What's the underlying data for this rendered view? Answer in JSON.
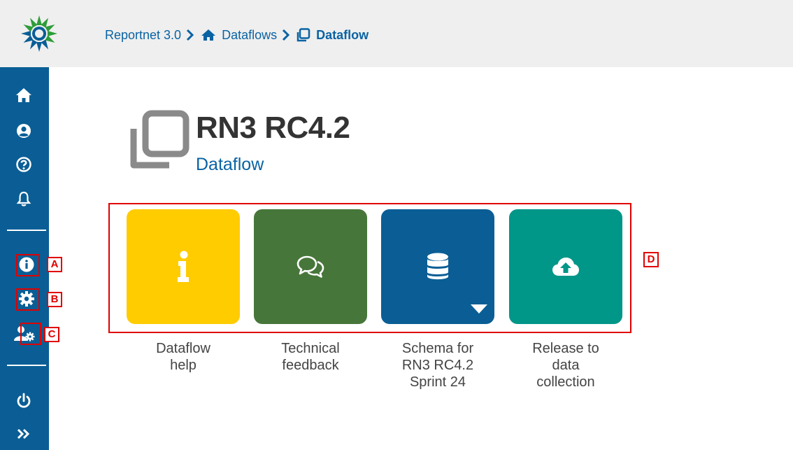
{
  "breadcrumb": {
    "items": [
      {
        "label": "Reportnet 3.0"
      },
      {
        "label": "Dataflows"
      },
      {
        "label": "Dataflow"
      }
    ]
  },
  "page": {
    "title": "RN3 RC4.2",
    "subtitle": "Dataflow"
  },
  "tiles": [
    {
      "caption_lines": [
        "Dataflow",
        "help"
      ],
      "color": "#ffcc00",
      "icon": "info-icon"
    },
    {
      "caption_lines": [
        "Technical",
        "feedback"
      ],
      "color": "#47763a",
      "icon": "comments-icon"
    },
    {
      "caption_lines": [
        "Schema for",
        "RN3 RC4.2",
        "Sprint 24"
      ],
      "color": "#0a5e95",
      "icon": "database-icon"
    },
    {
      "caption_lines": [
        "Release to",
        "data",
        "collection"
      ],
      "color": "#009688",
      "icon": "cloud-upload-icon"
    }
  ],
  "sidebar": {
    "icons": [
      "home-icon",
      "user-icon",
      "help-icon",
      "bell-icon",
      "info-icon",
      "gear-icon",
      "user-settings-icon",
      "power-icon",
      "expand-icon"
    ]
  },
  "markers": {
    "a": "A",
    "b": "B",
    "c": "C",
    "d": "D"
  },
  "colors": {
    "header_bg": "#efefef",
    "sidebar_bg": "#0a5e95",
    "link": "#0a63a3",
    "marker": "#e00000"
  }
}
